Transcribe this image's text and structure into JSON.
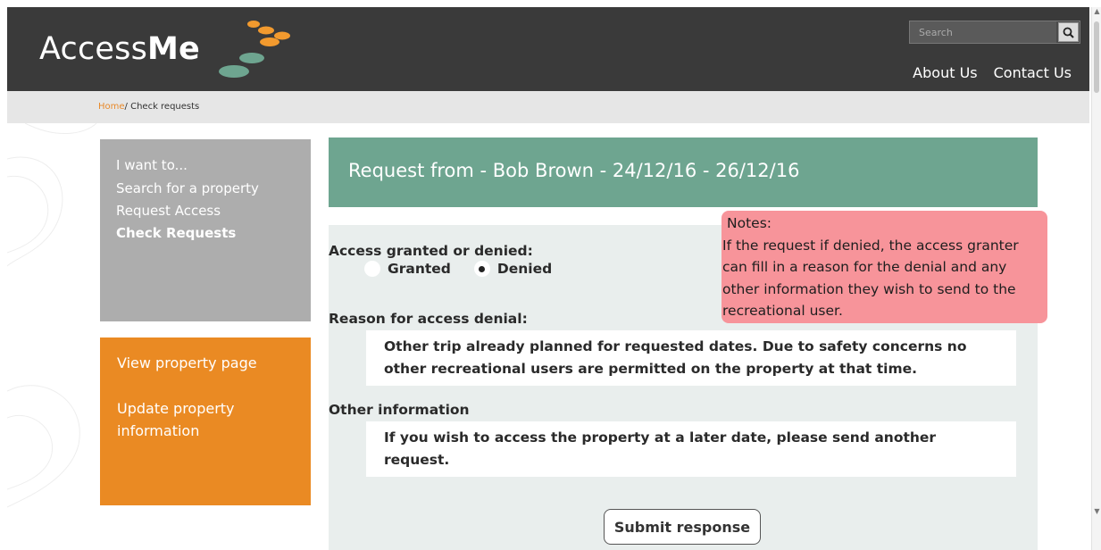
{
  "header": {
    "logo_light": "Access",
    "logo_bold": "Me",
    "search_placeholder": "Search",
    "nav": [
      "About Us",
      "Contact Us"
    ]
  },
  "breadcrumb": {
    "home": "Home",
    "separator": "/",
    "current": "Check requests"
  },
  "sidebar": {
    "heading": "I want to...",
    "links": [
      "Search for a property",
      "Request Access",
      "Check Requests"
    ],
    "active_link": "Check Requests",
    "actions": [
      "View property page",
      "Update property information"
    ]
  },
  "request": {
    "title": "Request from - Bob Brown - 24/12/16 - 26/12/16",
    "access_label": "Access granted or denied:",
    "options": [
      "Granted",
      "Denied"
    ],
    "selected_option": "Denied",
    "reason_label": "Reason for access denial:",
    "reason_text": "Other trip already planned for requested dates. Due to safety concerns no other recreational users are permitted on the property at that time.",
    "other_label": "Other information",
    "other_text": "If you wish to access the property at a later date, please send another request.",
    "submit_label": "Submit response"
  },
  "notes": {
    "title": "Notes:",
    "body": "If the request if denied, the access granter can fill in a reason for the denial and any other information they wish to send to the recreational user."
  },
  "colors": {
    "header_bg": "#3a3a3a",
    "title_bg": "#6ea590",
    "sidebar_grey": "#adadad",
    "sidebar_orange": "#ea8a23",
    "notes_bg": "#f7949a",
    "logo_orange": "#f29a2e",
    "logo_green": "#6ea590"
  },
  "icons": {
    "search": "magnifier-icon",
    "logo": "dots-logo-icon"
  }
}
